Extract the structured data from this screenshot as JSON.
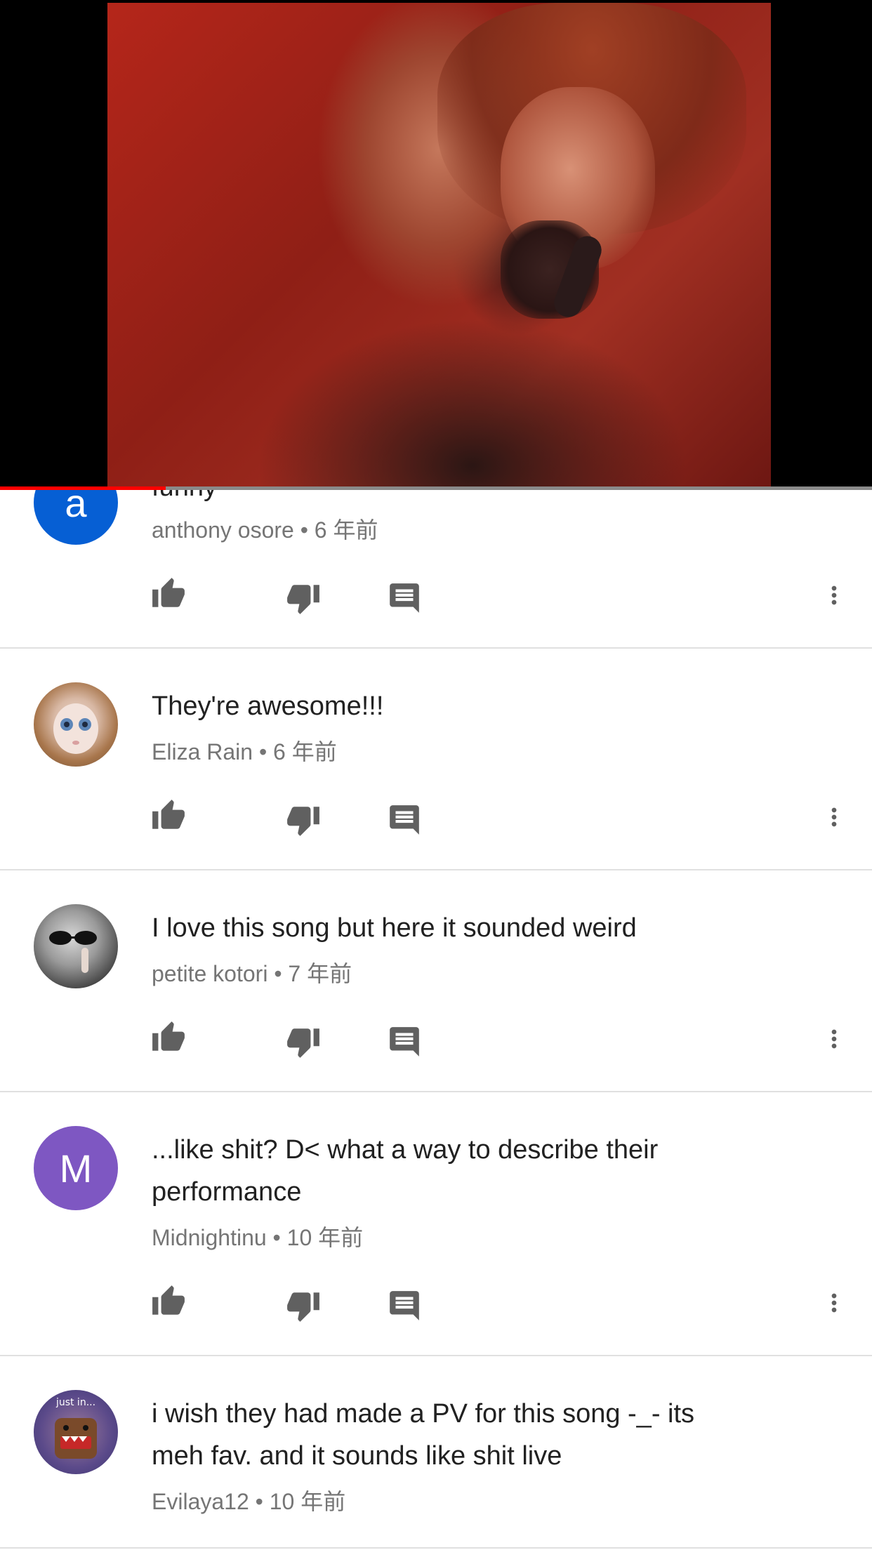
{
  "player": {
    "progress": 0.19,
    "buffered": 0.94
  },
  "comments": [
    {
      "text": "funny",
      "author": "anthony osore",
      "time": "6 年前",
      "avatar_letter": "a",
      "avatar_color": "#065fd4"
    },
    {
      "text": "They're awesome!!!",
      "author": "Eliza Rain",
      "time": "6 年前",
      "avatar_letter": "",
      "avatar_color": "#b08860"
    },
    {
      "text": "I love this song but here it sounded weird",
      "author": "petite kotori",
      "time": "7 年前",
      "avatar_letter": "",
      "avatar_color": "#444444"
    },
    {
      "text": "...like shit? D< what a way to describe their performance",
      "author": "Midnightinu",
      "time": "10 年前",
      "avatar_letter": "M",
      "avatar_color": "#7e57c2"
    },
    {
      "text": "i wish they had made a PV for this song -_- its meh fav. and it sounds like shit live",
      "author": "Evilaya12",
      "time": "10 年前",
      "avatar_letter": "",
      "avatar_color": "#5a4a8a",
      "avatar_caption": "just in..."
    }
  ],
  "icons": {
    "like": "thumb-up-icon",
    "dislike": "thumb-down-icon",
    "reply": "comment-icon",
    "menu": "more-vertical-icon"
  },
  "meta_separator": " • "
}
